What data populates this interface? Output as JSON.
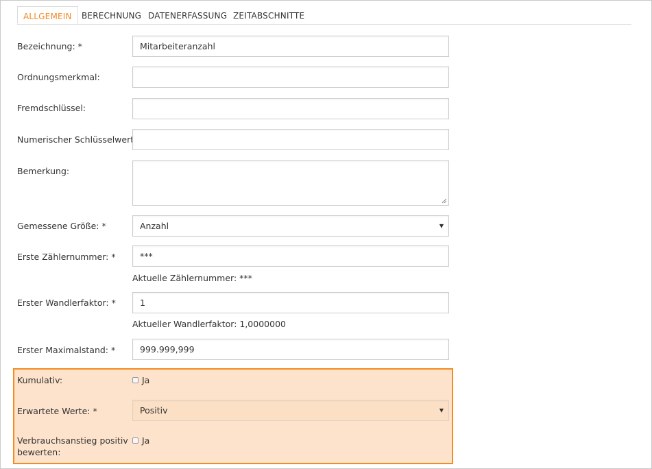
{
  "tabs": [
    "ALLGEMEIN",
    "BERECHNUNG",
    "DATENERFASSUNG",
    "ZEITABSCHNITTE"
  ],
  "fields": {
    "bezeichnung": {
      "label": "Bezeichnung: *",
      "value": "Mitarbeiteranzahl"
    },
    "ordnungsmerkmal": {
      "label": "Ordnungsmerkmal:",
      "value": ""
    },
    "fremdschluessel": {
      "label": "Fremdschlüssel:",
      "value": ""
    },
    "numerischer_schluesselwert": {
      "label": "Numerischer Schlüsselwert:",
      "value": ""
    },
    "bemerkung": {
      "label": "Bemerkung:",
      "value": ""
    },
    "gemessene_groesse": {
      "label": "Gemessene Größe: *",
      "value": "Anzahl"
    },
    "erste_zaehlernummer": {
      "label": "Erste Zählernummer: *",
      "value": "***",
      "hint": "Aktuelle Zählernummer: ***"
    },
    "erster_wandlerfaktor": {
      "label": "Erster Wandlerfaktor: *",
      "value": "1",
      "hint": "Aktueller Wandlerfaktor: 1,0000000"
    },
    "erster_maximalstand": {
      "label": "Erster Maximalstand: *",
      "value": "999.999,999"
    },
    "kumulativ": {
      "label": "Kumulativ:",
      "checkbox_label": "Ja",
      "checked": false
    },
    "erwartete_werte": {
      "label": "Erwartete Werte: *",
      "value": "Positiv"
    },
    "verbrauchsanstieg": {
      "label_line1": "Verbrauchsanstieg positiv",
      "label_line2": "bewerten:",
      "checkbox_label": "Ja",
      "checked": false
    }
  },
  "colors": {
    "accent": "#f08a24",
    "highlight_bg": "#fde3cc",
    "highlight_border": "#f58b1f"
  }
}
